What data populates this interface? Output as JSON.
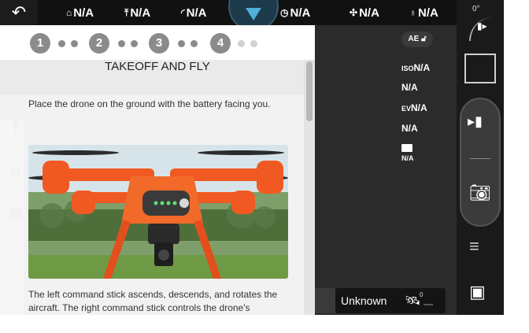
{
  "topbar": {
    "back_label": "",
    "stats": [
      {
        "icon": "home-distance-icon",
        "glyph": "⌂",
        "value": "N/A"
      },
      {
        "icon": "altitude-icon",
        "glyph": "⤒",
        "value": "N/A"
      },
      {
        "icon": "speed-gauge-icon",
        "glyph": "◜",
        "value": "N/A"
      },
      {
        "icon": "flight-time-icon",
        "glyph": "◷",
        "value": "N/A"
      },
      {
        "icon": "drone-battery-icon",
        "glyph": "✣",
        "value": "N/A"
      },
      {
        "icon": "controller-battery-icon",
        "glyph": "♁",
        "value": "N/A"
      }
    ]
  },
  "camera": {
    "gimbal_angle": "0°",
    "ae_label": "AE",
    "iso_prefix": "ISO",
    "iso_value": "N/A",
    "shutter_value": "N/A",
    "ev_prefix": "EV",
    "ev_value": "N/A",
    "wb_value": "N/A",
    "storage_value": "N/A"
  },
  "tutorial": {
    "steps": [
      "1",
      "2",
      "3",
      "4"
    ],
    "title": "TAKEOFF AND FLY",
    "text1": "Place the drone on the ground with the battery facing you.",
    "text2": "The left command stick ascends, descends, and rotates the aircraft. The right command stick controls the drone's"
  },
  "status": {
    "rc_label": "Unknown",
    "satellites": "0"
  },
  "colors": {
    "drone_orange": "#f05a22",
    "sky": "#cfe0ea",
    "grass": "#5f8f3e",
    "accent_blue": "#4fb0d8"
  }
}
